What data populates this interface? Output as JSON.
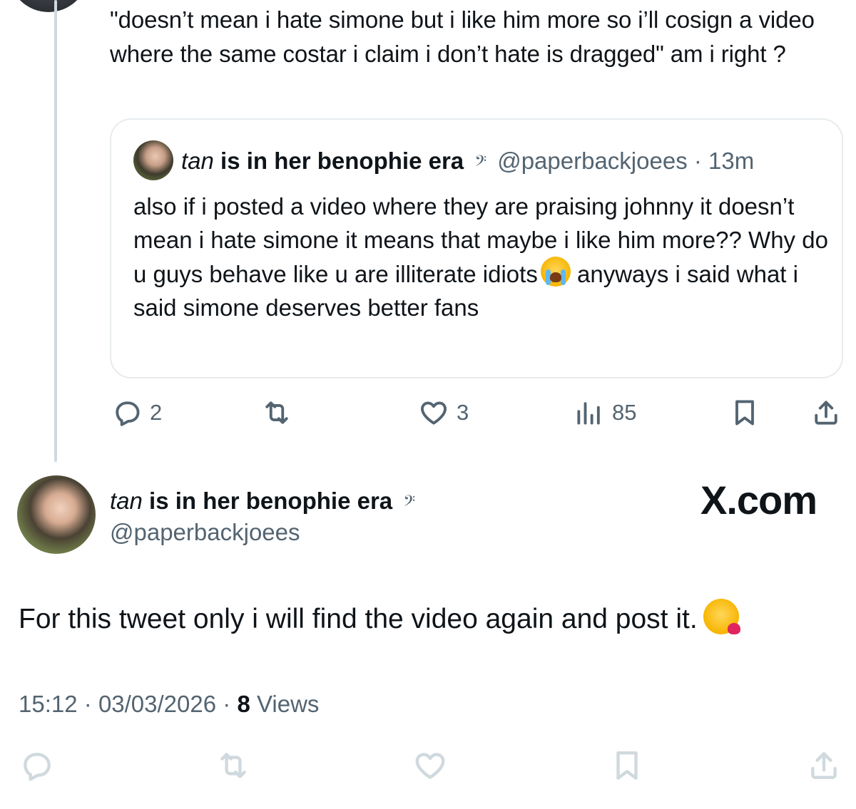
{
  "parent": {
    "text": "\"doesn’t mean i hate simone but i like him more so i’ll cosign a video where the same costar i claim i don’t hate is dragged\" am i right ?"
  },
  "quote": {
    "name_italic": "tan",
    "name_bold": "is in her benophie era",
    "clef": "𝄢",
    "handle": "@paperbackjoees",
    "dot": "·",
    "time": "13m",
    "text_before_emoji": "also if i posted a video where they are praising johnny it doesn’t mean i hate simone it means that maybe i like him more?? Why do u guys behave like u are illiterate idiots",
    "emoji": "crying-face",
    "text_after_emoji": " anyways i said what i said simone deserves better fans"
  },
  "actions": {
    "replies": "2",
    "retweets": "",
    "likes": "3",
    "views": "85"
  },
  "tweet": {
    "name_italic": "tan",
    "name_bold": "is in her benophie era",
    "clef": "𝄢",
    "handle": "@paperbackjoees",
    "brand": "X.com",
    "text": "For this tweet only i will find the video again and post it.",
    "emoji": "kissing-face",
    "time": "15:12",
    "date": "03/03/2026",
    "separator": "·",
    "views_count": "8",
    "views_label": "Views"
  },
  "colors": {
    "text": "#0f1419",
    "muted": "#536471",
    "border": "#e7ebee",
    "thread_line": "#cfd9de",
    "bottom_icons": "#cfd9de"
  }
}
